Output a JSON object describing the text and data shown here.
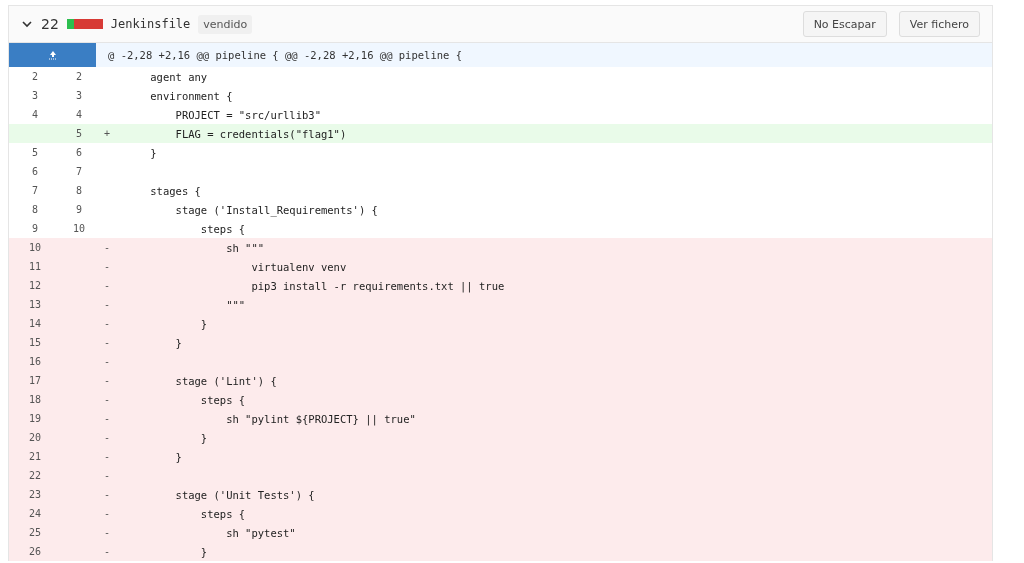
{
  "file_header": {
    "expanded": true,
    "count": "22",
    "name": "Jenkinsfile",
    "badge": "vendido",
    "buttons": [
      "No Escapar",
      "Ver fichero"
    ]
  },
  "hunk": {
    "text": "@ -2,28 +2,16 @@ pipeline { @@ -2,28 +2,16 @@ pipeline {"
  },
  "rows": [
    {
      "kind": "context",
      "old": "2",
      "new": "2",
      "code": "    agent any"
    },
    {
      "kind": "context",
      "old": "3",
      "new": "3",
      "code": "    environment {"
    },
    {
      "kind": "context",
      "old": "4",
      "new": "4",
      "code": "        PROJECT = \"src/urllib3\""
    },
    {
      "kind": "added",
      "new": "5",
      "sign": "+",
      "code": "        FLAG = credentials(\"flag1\")"
    },
    {
      "kind": "context",
      "old": "5",
      "new": "6",
      "code": "    }"
    },
    {
      "kind": "context",
      "old": "6",
      "new": "7"
    },
    {
      "kind": "context",
      "old": "7",
      "new": "8",
      "code": "    stages {"
    },
    {
      "kind": "context",
      "old": "8",
      "new": "9",
      "code": "        stage ('Install_Requirements') {"
    },
    {
      "kind": "context",
      "old": "9",
      "new": "10",
      "code": "            steps {"
    },
    {
      "kind": "removed",
      "old": "10",
      "sign": "-",
      "code": "                sh \"\"\""
    },
    {
      "kind": "removed",
      "old": "11",
      "sign": "-",
      "code": "                    virtualenv venv"
    },
    {
      "kind": "removed",
      "old": "12",
      "sign": "-",
      "code": "                    pip3 install -r requirements.txt || true"
    },
    {
      "kind": "removed",
      "old": "13",
      "sign": "-",
      "code": "                \"\"\""
    },
    {
      "kind": "removed",
      "old": "14",
      "sign": "-",
      "code": "            }"
    },
    {
      "kind": "removed",
      "old": "15",
      "sign": "-",
      "code": "        }"
    },
    {
      "kind": "removed",
      "old": "16",
      "sign": "-"
    },
    {
      "kind": "removed",
      "old": "17",
      "sign": "-",
      "code": "        stage ('Lint') {"
    },
    {
      "kind": "removed",
      "old": "18",
      "sign": "-",
      "code": "            steps {"
    },
    {
      "kind": "removed",
      "old": "19",
      "sign": "-",
      "code": "                sh \"pylint ${PROJECT} || true\""
    },
    {
      "kind": "removed",
      "old": "20",
      "sign": "-",
      "code": "            }"
    },
    {
      "kind": "removed",
      "old": "21",
      "sign": "-",
      "code": "        }"
    },
    {
      "kind": "removed",
      "old": "22",
      "sign": "-"
    },
    {
      "kind": "removed",
      "old": "23",
      "sign": "-",
      "code": "        stage ('Unit Tests') {"
    },
    {
      "kind": "removed",
      "old": "24",
      "sign": "-",
      "code": "            steps {"
    },
    {
      "kind": "removed",
      "old": "25",
      "sign": "-",
      "code": "                sh \"pytest\""
    },
    {
      "kind": "removed",
      "old": "26",
      "sign": "-",
      "code": "            }"
    }
  ]
}
